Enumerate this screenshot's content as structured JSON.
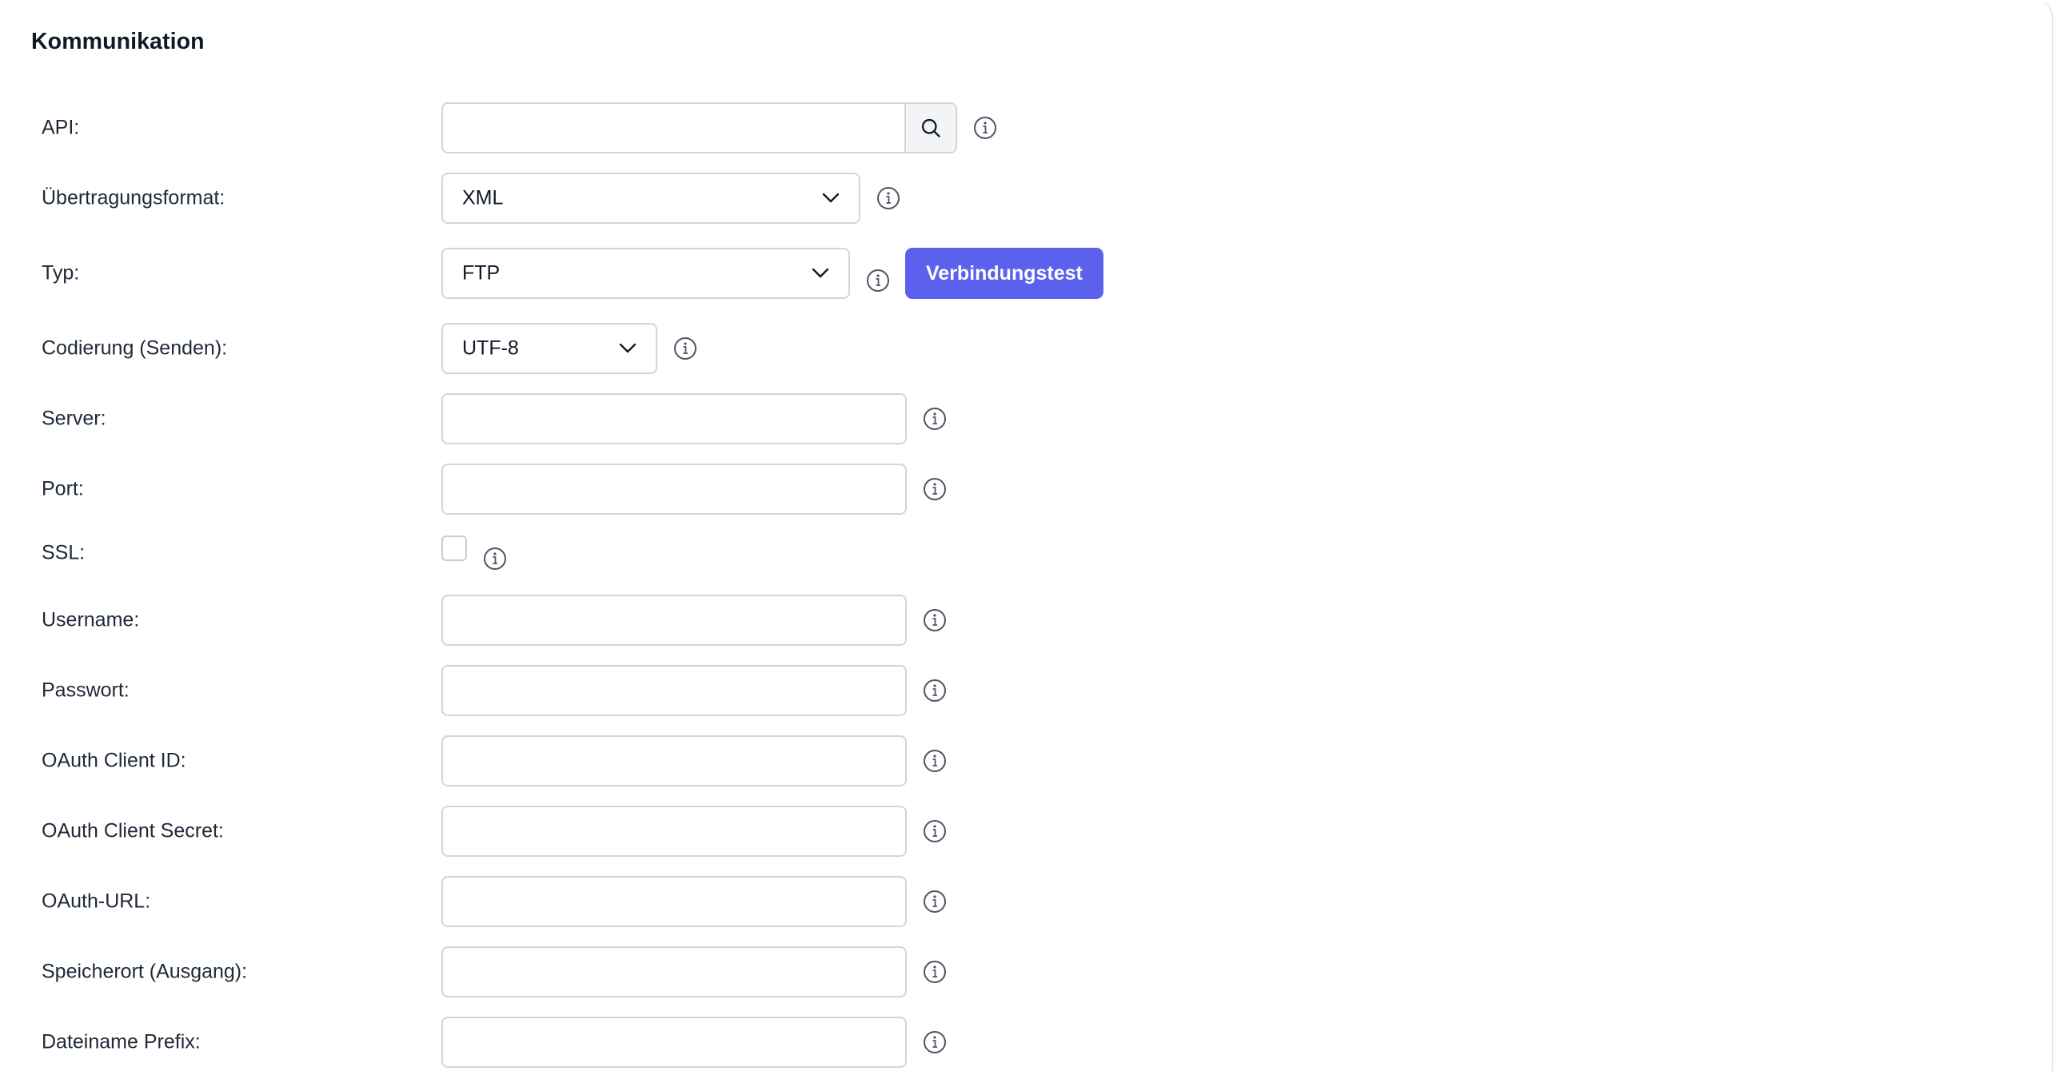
{
  "section": {
    "title": "Kommunikation"
  },
  "form": {
    "api": {
      "label": "API:",
      "value": "",
      "placeholder": ""
    },
    "format": {
      "label": "Übertragungsformat:",
      "selected": "XML"
    },
    "type": {
      "label": "Typ:",
      "selected": "FTP",
      "test_button": "Verbindungstest"
    },
    "encoding": {
      "label": "Codierung (Senden):",
      "selected": "UTF-8"
    },
    "server": {
      "label": "Server:",
      "value": ""
    },
    "port": {
      "label": "Port:",
      "value": ""
    },
    "ssl": {
      "label": "SSL:",
      "checked": false
    },
    "username": {
      "label": "Username:",
      "value": ""
    },
    "password": {
      "label": "Passwort:",
      "value": ""
    },
    "oauth_client_id": {
      "label": "OAuth Client ID:",
      "value": ""
    },
    "oauth_client_secret": {
      "label": "OAuth Client Secret:",
      "value": ""
    },
    "oauth_url": {
      "label": "OAuth-URL:",
      "value": ""
    },
    "output_location": {
      "label": "Speicherort (Ausgang):",
      "value": ""
    },
    "filename_prefix": {
      "label": "Dateiname Prefix:",
      "value": ""
    }
  },
  "icons": {
    "search": "search-icon",
    "info": "info-icon",
    "chevron": "chevron-down-icon"
  },
  "colors": {
    "primary_button": "#5b61ec",
    "input_border": "#d1d5db",
    "info_icon": "#4b5563"
  }
}
